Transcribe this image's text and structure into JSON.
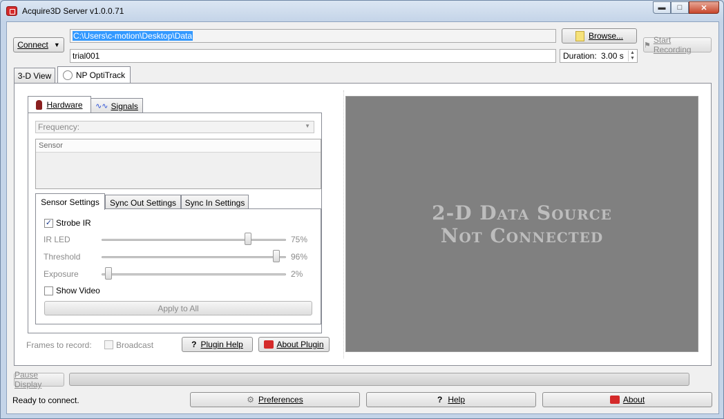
{
  "window": {
    "title": "Acquire3D Server v1.0.0.71",
    "minimize_glyph": "▬",
    "maximize_glyph": "□",
    "close_glyph": "✕"
  },
  "toolbar": {
    "connect_label": "Connect",
    "path_value": "C:\\Users\\c-motion\\Desktop\\Data",
    "browse_label": "Browse...",
    "trial_value": "trial001",
    "duration_label": "Duration:",
    "duration_value": "3.00 s",
    "start_recording_label": "Start Recording"
  },
  "main_tabs": [
    {
      "label": "3-D View"
    },
    {
      "label": "NP OptiTrack"
    }
  ],
  "plugin": {
    "sub_tabs": [
      {
        "label": "Hardware"
      },
      {
        "label": "Signals"
      }
    ],
    "frequency_placeholder": "Frequency:",
    "sensor_header": "Sensor",
    "settings_tabs": [
      {
        "label": "Sensor Settings"
      },
      {
        "label": "Sync Out Settings"
      },
      {
        "label": "Sync In Settings"
      }
    ],
    "strobe_ir_label": "Strobe IR",
    "strobe_ir_checked": true,
    "sliders": [
      {
        "label": "IR LED",
        "value_text": "75%",
        "value": 0.75
      },
      {
        "label": "Threshold",
        "value_text": "96%",
        "value": 0.96
      },
      {
        "label": "Exposure",
        "value_text": "2%",
        "value": 0.02
      }
    ],
    "show_video_label": "Show Video",
    "show_video_checked": false,
    "apply_all_label": "Apply to All",
    "frames_label": "Frames to record:",
    "broadcast_label": "Broadcast",
    "plugin_help_label": "Plugin Help",
    "about_plugin_label": "About Plugin"
  },
  "preview": {
    "line1": "2-D Data Source",
    "line2": "Not Connected"
  },
  "bottom": {
    "pause_display_label": "Pause Display",
    "progress": 0.0,
    "status_text": "Ready to connect.",
    "preferences_label": "Preferences",
    "help_label": "Help",
    "about_label": "About"
  },
  "colors": {
    "accent": "#3399ff",
    "preview_bg": "#808080",
    "preview_text": "#bdbdbd",
    "brand_red": "#d42a2a"
  }
}
